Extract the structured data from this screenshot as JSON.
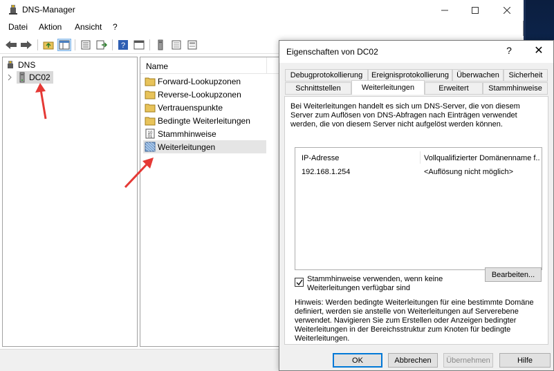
{
  "window": {
    "title": "DNS-Manager",
    "menu": [
      "Datei",
      "Aktion",
      "Ansicht",
      "?"
    ]
  },
  "tree": {
    "root": "DNS",
    "server": "DC02"
  },
  "list": {
    "column_name": "Name",
    "items": [
      {
        "label": "Forward-Lookupzonen",
        "icon": "folder-icon"
      },
      {
        "label": "Reverse-Lookupzonen",
        "icon": "folder-icon"
      },
      {
        "label": "Vertrauenspunkte",
        "icon": "folder-icon"
      },
      {
        "label": "Bedingte Weiterleitungen",
        "icon": "folder-icon"
      },
      {
        "label": "Stammhinweise",
        "icon": "root-hints-icon"
      },
      {
        "label": "Weiterleitungen",
        "icon": "forwarders-icon"
      }
    ]
  },
  "dialog": {
    "title": "Eigenschaften von DC02",
    "help": "?",
    "close": "✕",
    "tabs_row1": [
      "Debugprotokollierung",
      "Ereignisprotokollierung",
      "Überwachen",
      "Sicherheit"
    ],
    "tabs_row2": [
      "Schnittstellen",
      "Weiterleitungen",
      "Erweitert",
      "Stammhinweise"
    ],
    "description": "Bei Weiterleitungen handelt es sich um DNS-Server, die von diesem Server zum Auflösen von DNS-Abfragen nach Einträgen verwendet werden, die von diesem Server nicht aufgelöst werden können.",
    "table": {
      "col_ip": "IP-Adresse",
      "col_fqdn": "Vollqualifizierter Domänenname f...",
      "rows": [
        {
          "ip": "192.168.1.254",
          "fqdn": "<Auflösung nicht möglich>"
        }
      ]
    },
    "use_root_hints_label": "Stammhinweise verwenden, wenn keine Weiterleitungen verfügbar sind",
    "use_root_hints_checked": true,
    "edit_button": "Bearbeiten...",
    "hint": "Hinweis: Werden bedingte Weiterleitungen für eine bestimmte Domäne definiert, werden sie anstelle von Weiterleitungen auf Serverebene verwendet. Navigieren Sie zum Erstellen oder Anzeigen bedingter Weiterleitungen in der Bereichsstruktur zum Knoten für bedingte Weiterleitungen.",
    "buttons": {
      "ok": "OK",
      "cancel": "Abbrechen",
      "apply": "Übernehmen",
      "help": "Hilfe"
    }
  },
  "colors": {
    "accent": "#0078d7",
    "annotation_arrow": "#e53935"
  }
}
